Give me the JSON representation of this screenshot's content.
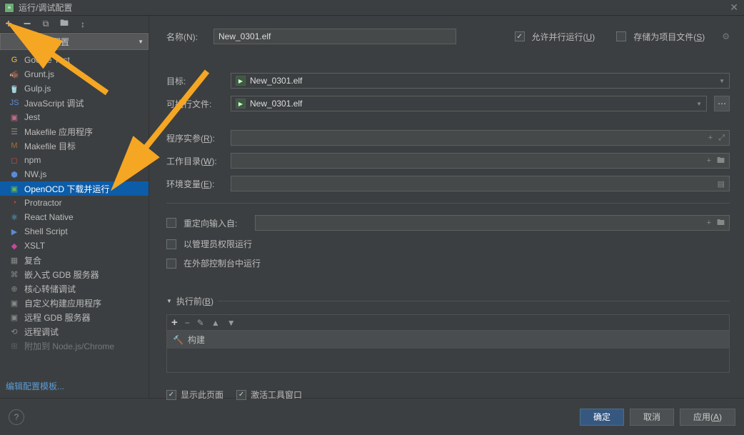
{
  "title": "运行/调试配置",
  "toolbar": {
    "addNewConfig": "添加新配置"
  },
  "tree": [
    {
      "icon": "G",
      "color": "#f0c24b",
      "label": "Google Test",
      "id": "google-test"
    },
    {
      "icon": "🐗",
      "color": "#d08f57",
      "label": "Grunt.js",
      "id": "grunt"
    },
    {
      "icon": "🥤",
      "color": "#d14b4b",
      "label": "Gulp.js",
      "id": "gulp"
    },
    {
      "icon": "JS",
      "color": "#5a8bd6",
      "label": "JavaScript 调试",
      "id": "js-debug"
    },
    {
      "icon": "▣",
      "color": "#c16b85",
      "label": "Jest",
      "id": "jest"
    },
    {
      "icon": "☰",
      "color": "#888",
      "label": "Makefile 应用程序",
      "id": "makefile-app"
    },
    {
      "icon": "M",
      "color": "#a86e32",
      "label": "Makefile 目标",
      "id": "makefile-target"
    },
    {
      "icon": "◻",
      "color": "#d14b4b",
      "label": "npm",
      "id": "npm"
    },
    {
      "icon": "⬢",
      "color": "#5a8bd6",
      "label": "NW.js",
      "id": "nwjs"
    },
    {
      "icon": "▣",
      "color": "#5fb25f",
      "label": "OpenOCD 下载并运行",
      "id": "openocd",
      "selected": true
    },
    {
      "icon": "◔",
      "color": "#d14b4b",
      "label": "Protractor",
      "id": "protractor"
    },
    {
      "icon": "⚛",
      "color": "#5ac8fa",
      "label": "React Native",
      "id": "react-native"
    },
    {
      "icon": "▶",
      "color": "#5a8bd6",
      "label": "Shell Script",
      "id": "shell"
    },
    {
      "icon": "◆",
      "color": "#c14b9e",
      "label": "XSLT",
      "id": "xslt"
    },
    {
      "icon": "▦",
      "color": "#888",
      "label": "复合",
      "id": "compound"
    },
    {
      "icon": "⌘",
      "color": "#888",
      "label": "嵌入式 GDB 服务器",
      "id": "embedded-gdb"
    },
    {
      "icon": "⊕",
      "color": "#888",
      "label": "核心转储调试",
      "id": "core-dump"
    },
    {
      "icon": "▣",
      "color": "#888",
      "label": "自定义构建应用程序",
      "id": "custom-build"
    },
    {
      "icon": "▣",
      "color": "#888",
      "label": "远程 GDB 服务器",
      "id": "remote-gdb"
    },
    {
      "icon": "⟲",
      "color": "#888",
      "label": "远程调试",
      "id": "remote-debug"
    },
    {
      "icon": "⊞",
      "color": "#888",
      "label": "附加到 Node.js/Chrome",
      "id": "attach-node",
      "faded": true
    }
  ],
  "editTemplates": "编辑配置模板...",
  "form": {
    "nameLabel": "名称(N):",
    "nameValue": "New_0301.elf",
    "allowParallel": "允许并行运行(U)",
    "saveAsProject": "存储为项目文件(S)",
    "targetLabel": "目标:",
    "targetValue": "New_0301.elf",
    "execLabel": "可执行文件:",
    "execValue": "New_0301.elf",
    "argsLabel": "程序实参(R):",
    "workdirLabel": "工作目录(W):",
    "envLabel": "环境变量(E):",
    "redirectStdin": "重定向输入自:",
    "runAsAdmin": "以管理员权限运行",
    "runInExtConsole": "在外部控制台中运行",
    "beforeLaunch": "执行前(B)",
    "buildTask": "构建",
    "showThisPage": "显示此页面",
    "activateToolWindow": "激活工具窗口"
  },
  "footer": {
    "ok": "确定",
    "cancel": "取消",
    "apply": "应用(A)"
  }
}
